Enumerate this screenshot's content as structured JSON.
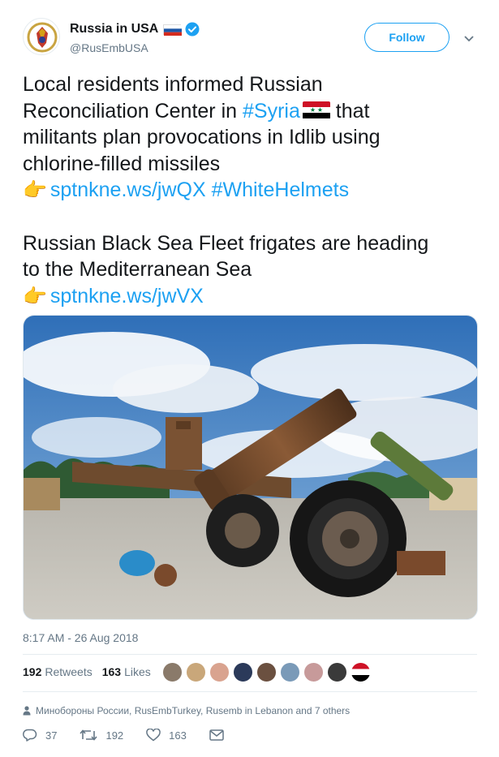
{
  "account": {
    "display_name": "Russia in USA",
    "handle": "@RusEmbUSA",
    "verified": true,
    "follow_label": "Follow"
  },
  "tweet": {
    "paragraph1": {
      "line_a": "Local residents informed Russian",
      "line_b_prefix": "Reconciliation Center in ",
      "hashtag_syria": "#Syria",
      "line_b_suffix": " that",
      "line_c": "militants plan provocations in Idlib using",
      "line_d": "chlorine-filled missiles",
      "link1": "sptnkne.ws/jwQX",
      "hashtag_whitehelmets": "#WhiteHelmets"
    },
    "paragraph2": {
      "line_a": "Russian Black Sea Fleet frigates are heading",
      "line_b": "to the Mediterranean Sea",
      "link2": "sptnkne.ws/jwVX"
    }
  },
  "timestamp": "8:17 AM - 26 Aug 2018",
  "stats": {
    "retweets_count": "192",
    "retweets_label": "Retweets",
    "likes_count": "163",
    "likes_label": "Likes"
  },
  "social_context": "Минобороны России, RusEmbTurkey, Rusemb in Lebanon and 7 others",
  "actions": {
    "replies": "37",
    "retweets": "192",
    "likes": "163"
  },
  "colors": {
    "link": "#1da1f2",
    "text": "#14171a",
    "muted": "#657786"
  }
}
